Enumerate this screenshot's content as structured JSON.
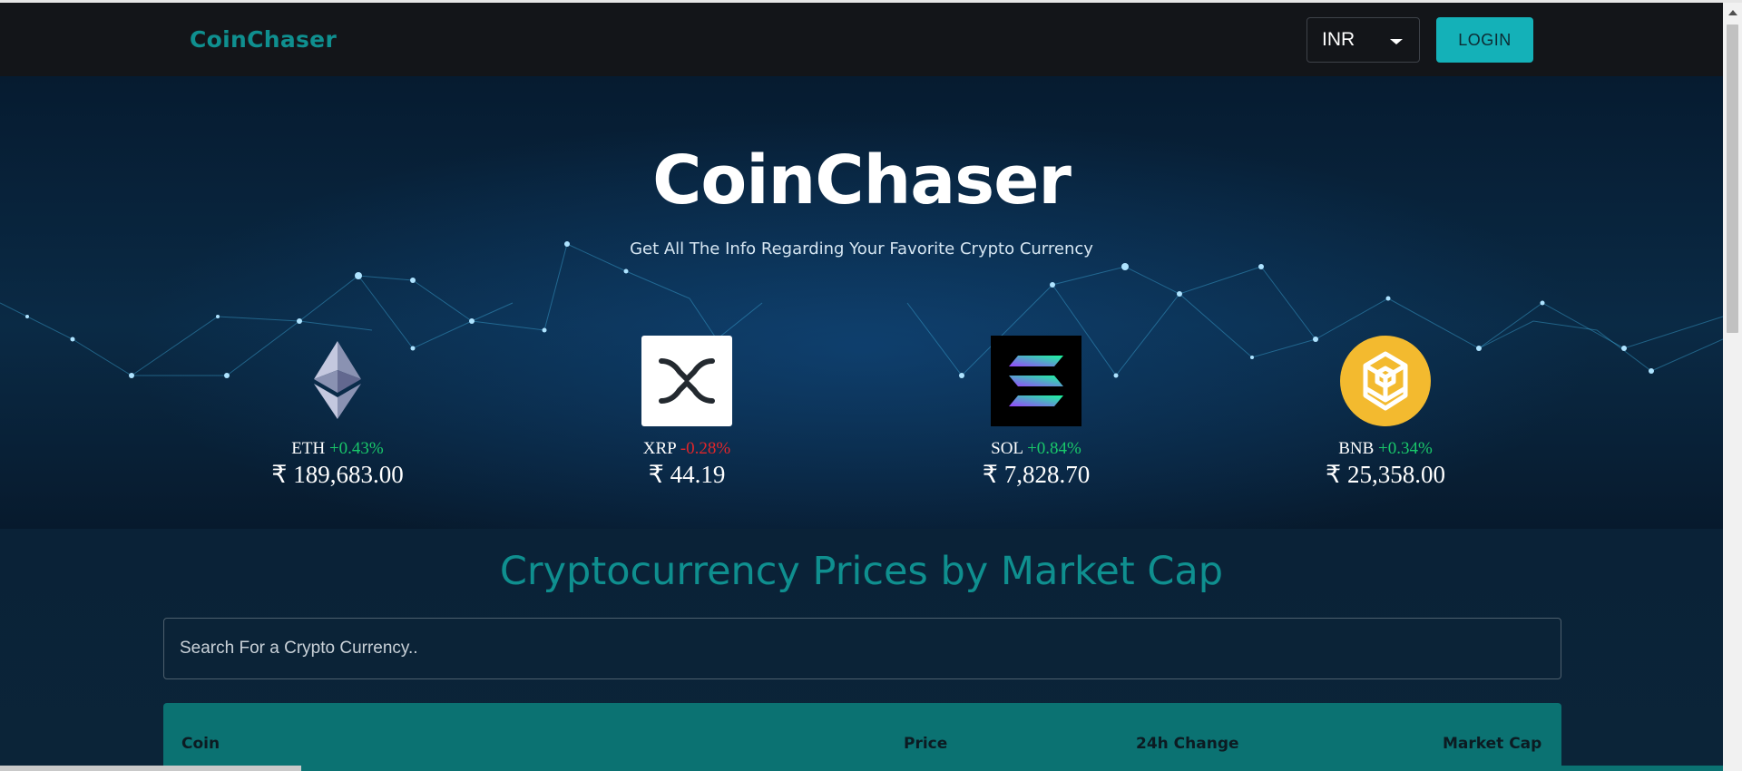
{
  "header": {
    "brand": "CoinChaser",
    "currency": "INR",
    "login_label": "LOGIN"
  },
  "hero": {
    "title": "CoinChaser",
    "subtitle": "Get All The Info Regarding Your Favorite Crypto Currency",
    "coins": [
      {
        "symbol": "ETH",
        "change": "+0.43%",
        "price": "₹ 189,683.00",
        "icon": "ethereum-icon"
      },
      {
        "symbol": "XRP",
        "change": "-0.28%",
        "price": "₹ 44.19",
        "icon": "xrp-icon"
      },
      {
        "symbol": "SOL",
        "change": "+0.84%",
        "price": "₹ 7,828.70",
        "icon": "solana-icon"
      },
      {
        "symbol": "BNB",
        "change": "+0.34%",
        "price": "₹ 25,358.00",
        "icon": "bnb-icon"
      }
    ]
  },
  "market": {
    "title": "Cryptocurrency Prices by Market Cap",
    "search_placeholder": "Search For a Crypto Currency..",
    "columns": [
      "Coin",
      "Price",
      "24h Change",
      "Market Cap"
    ]
  },
  "colors": {
    "accent": "#14b1b8",
    "brand": "#0f8f8f",
    "positive": "#19c86a",
    "negative": "#e2262a",
    "header_bg": "#131519",
    "table_header": "#0b7272"
  }
}
